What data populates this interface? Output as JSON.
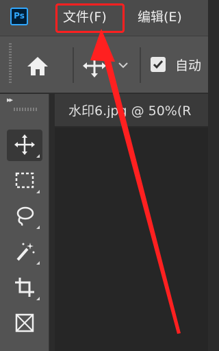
{
  "app": {
    "logo_text": "Ps"
  },
  "menu": {
    "file_label": "文件(F)",
    "edit_label": "编辑(E)"
  },
  "options_bar": {
    "auto_label": "自动",
    "auto_checked": true
  },
  "document": {
    "tab_title": "水印6.jpg @ 50%(R"
  },
  "tools": [
    "move-tool",
    "rectangular-marquee-tool",
    "lasso-tool",
    "magic-wand-tool",
    "crop-tool",
    "frame-tool"
  ],
  "annotation": {
    "highlight_color": "#ff2020",
    "arrow_color": "#ff2020"
  }
}
